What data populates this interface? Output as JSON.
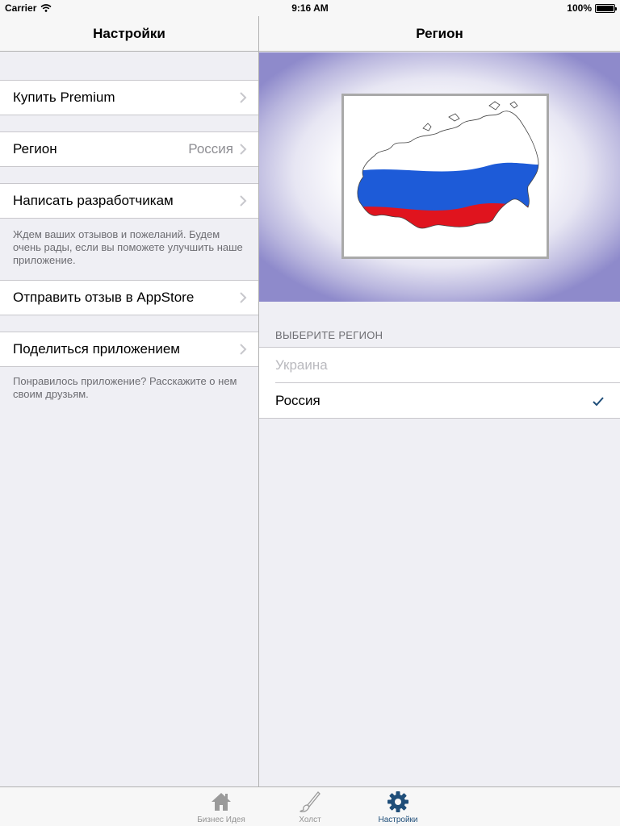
{
  "status_bar": {
    "carrier": "Carrier",
    "time": "9:16 AM",
    "battery": "100%",
    "battery_level": 1.0
  },
  "master": {
    "title": "Настройки",
    "cells": [
      {
        "label": "Купить Premium",
        "detail": ""
      },
      {
        "label": "Регион",
        "detail": "Россия"
      },
      {
        "label": "Написать разработчикам",
        "detail": ""
      },
      {
        "label": "Отправить отзыв в AppStore",
        "detail": ""
      },
      {
        "label": "Поделиться приложением",
        "detail": ""
      }
    ],
    "notes": {
      "feedback": "Ждем ваших отзывов и пожеланий. Будем очень рады, если вы поможете улучшить наше приложение.",
      "share": "Понравилось приложение? Расскажите о нем своим друзьям."
    }
  },
  "detail": {
    "title": "Регион",
    "flag": "russia-flag-map",
    "section_header": "ВЫБЕРИТЕ РЕГИОН",
    "options": [
      {
        "label": "Украина",
        "selected": false,
        "enabled": false
      },
      {
        "label": "Россия",
        "selected": true,
        "enabled": true
      }
    ]
  },
  "tabs": [
    {
      "label": "Бизнес Идея",
      "icon": "home-icon",
      "active": false
    },
    {
      "label": "Холст",
      "icon": "brush-icon",
      "active": false
    },
    {
      "label": "Настройки",
      "icon": "gear-icon",
      "active": true
    }
  ],
  "colors": {
    "accent": "#1f4e79",
    "inactive_tab": "#929292",
    "flag_white": "#ffffff",
    "flag_blue": "#1d5bd8",
    "flag_red": "#e0141e"
  }
}
